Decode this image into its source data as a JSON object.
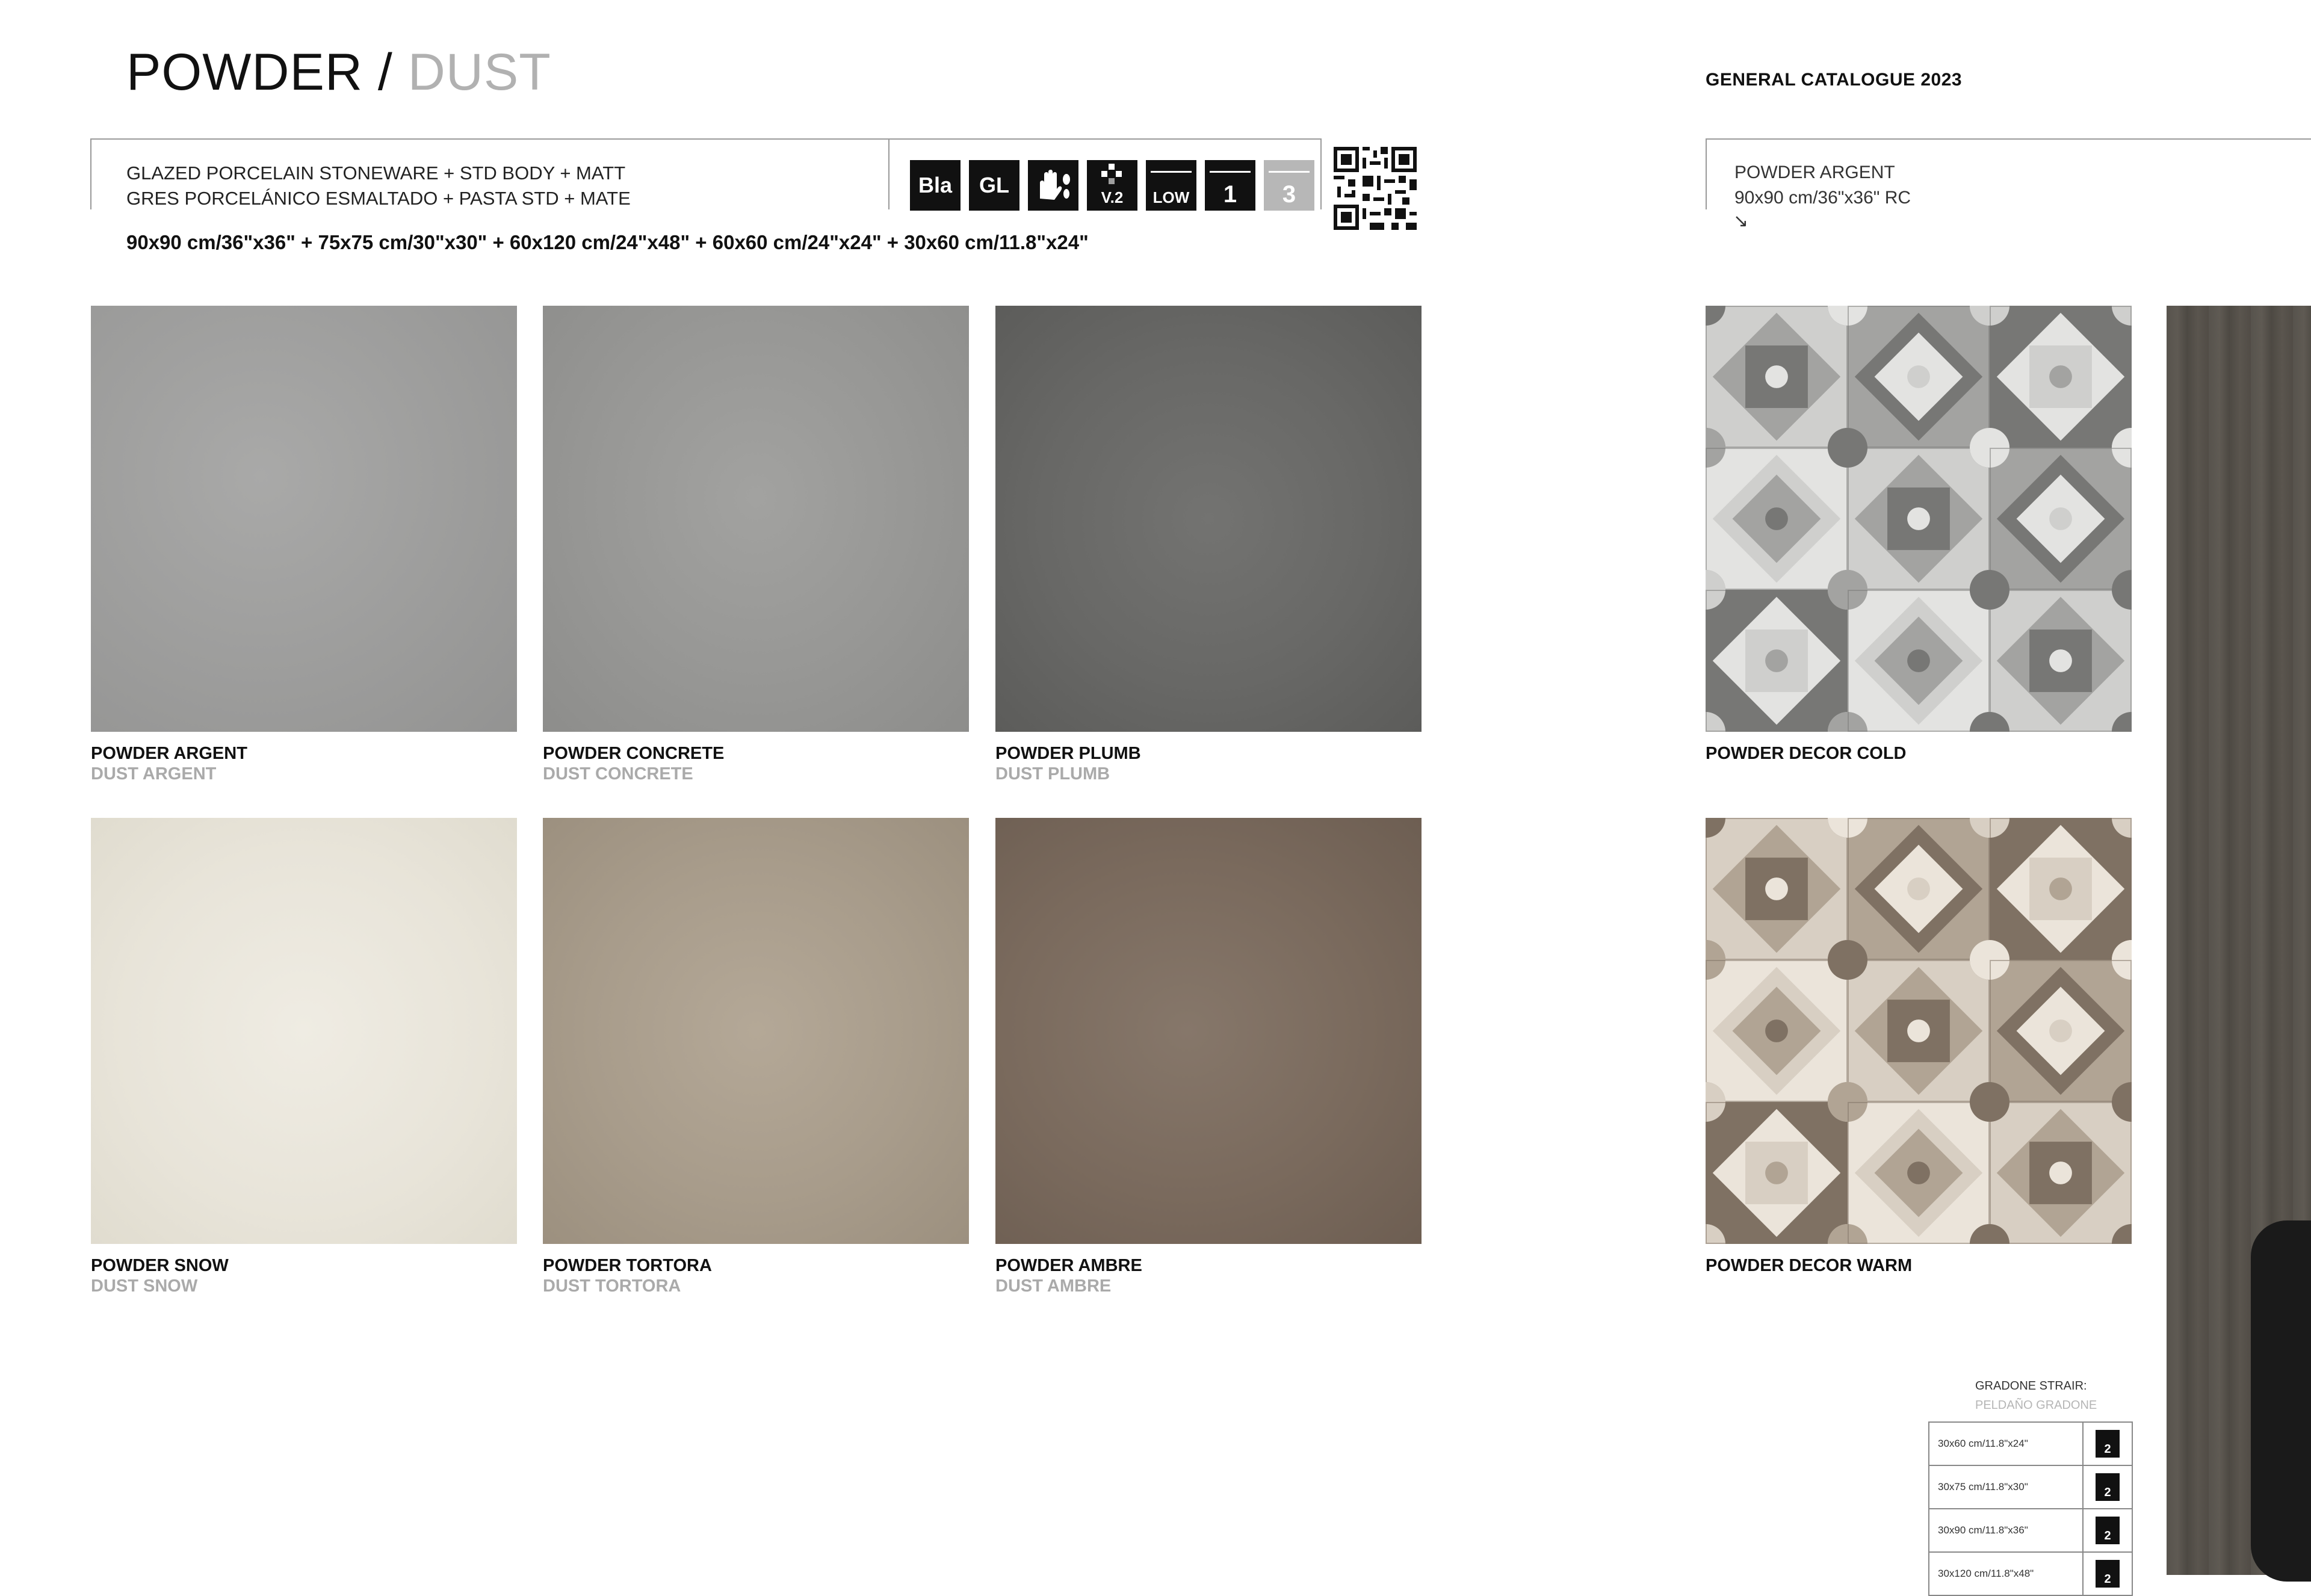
{
  "header": {
    "title_main": "POWDER",
    "title_sep": "/",
    "title_sub": "DUST",
    "catalogue": "GENERAL CATALOGUE 2023"
  },
  "spec": {
    "line1": "GLAZED PORCELAIN STONEWARE + STD BODY + MATT",
    "line2": "GRES PORCELÁNICO ESMALTADO + PASTA STD + MATE",
    "formats": "90x90 cm/36\"x36\" + 75x75 cm/30\"x30\" + 60x120 cm/24\"x48\" + 60x60 cm/24\"x24\" + 30x60 cm/11.8\"x24\""
  },
  "badges": [
    {
      "icon": "bla-icon",
      "label": "Bla"
    },
    {
      "icon": "gl-icon",
      "label": "GL"
    },
    {
      "icon": "hand-foot-icon",
      "label": ""
    },
    {
      "icon": "variation-icon",
      "label": "V.2"
    },
    {
      "icon": "slip-low-icon",
      "label": "LOW"
    },
    {
      "icon": "traffic-1-icon",
      "label": "1"
    },
    {
      "icon": "traffic-3-icon",
      "label": "3"
    }
  ],
  "right_spec": {
    "line1": "POWDER ARGENT",
    "line2": "90x90 cm/36\"x36\" RC",
    "arrow": "↘"
  },
  "tiles": [
    {
      "name": "POWDER ARGENT",
      "sub": "DUST ARGENT",
      "color": "#9d9d9c"
    },
    {
      "name": "POWDER CONCRETE",
      "sub": "DUST CONCRETE",
      "color": "#979795"
    },
    {
      "name": "POWDER PLUMB",
      "sub": "DUST PLUMB",
      "color": "#686866"
    },
    {
      "name": "POWDER SNOW",
      "sub": "DUST SNOW",
      "color": "#e8e4d9"
    },
    {
      "name": "POWDER TORTORA",
      "sub": "DUST TORTORA",
      "color": "#a89c8b"
    },
    {
      "name": "POWDER AMBRE",
      "sub": "DUST AMBRE",
      "color": "#7a6a5d"
    }
  ],
  "decors": [
    {
      "name": "POWDER DECOR COLD",
      "palette": [
        "#cfcfcd",
        "#a3a3a1",
        "#777775",
        "#e3e3e1"
      ]
    },
    {
      "name": "POWDER DECOR WARM",
      "palette": [
        "#d8cfc3",
        "#b1a494",
        "#7f7163",
        "#ebe4da"
      ]
    }
  ],
  "stair": {
    "title": "GRADONE STRAIR:",
    "subtitle": "PELDAÑO GRADONE",
    "rows": [
      {
        "size": "30x60 cm/11.8\"x24\"",
        "value": "2"
      },
      {
        "size": "30x75 cm/11.8\"x30\"",
        "value": "2"
      },
      {
        "size": "30x90 cm/11.8\"x36\"",
        "value": "2"
      },
      {
        "size": "30x120 cm/11.8\"x48\"",
        "value": "2"
      }
    ]
  }
}
